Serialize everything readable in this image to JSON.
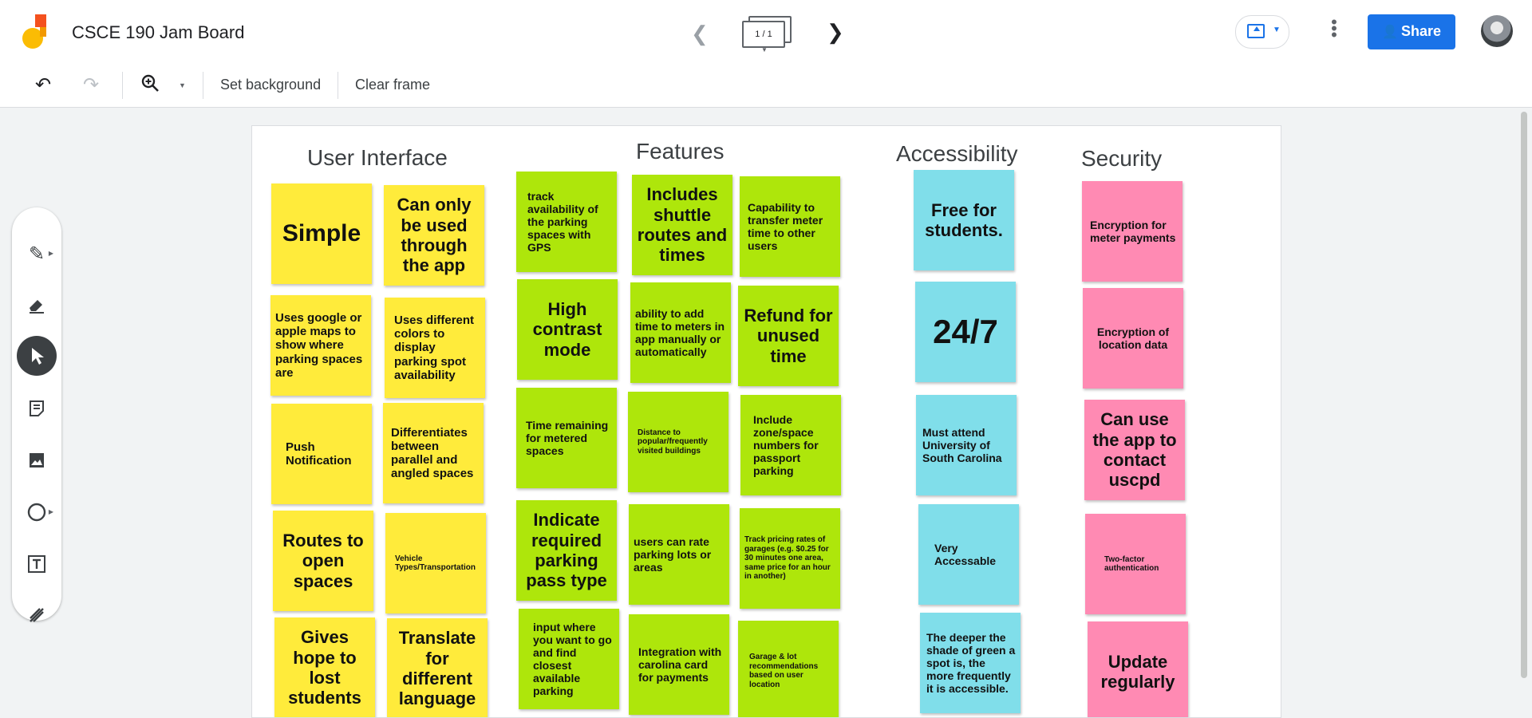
{
  "header": {
    "title": "CSCE 190 Jam Board",
    "frame_indicator": "1 / 1",
    "share_label": "Share"
  },
  "toolbar": {
    "set_background": "Set background",
    "clear_frame": "Clear frame"
  },
  "columns": {
    "ui": "User Interface",
    "features": "Features",
    "accessibility": "Accessibility",
    "security": "Security"
  },
  "notes": {
    "ui": [
      "Simple",
      "Can only be used through the app",
      "Uses google or apple maps to show where parking spaces are",
      "Uses different colors to display parking spot availability",
      "Push Notification",
      "Differentiates between parallel and angled spaces",
      "Routes to open spaces",
      "Vehicle Types/Transportation",
      "Gives hope to lost students",
      "Translate for different language"
    ],
    "features": [
      "track availability of the parking spaces with GPS",
      "Includes shuttle routes and times",
      "Capability to transfer meter time to other users",
      "High contrast mode",
      "ability to add time to meters in app manually or automatically",
      "Refund for unused time",
      "Time remaining for metered spaces",
      "Distance to popular/frequently visited buildings",
      "Include zone/space numbers for passport parking",
      "Indicate required parking pass type",
      "users can rate parking lots or areas",
      "Track pricing rates of garages (e.g. $0.25 for 30 minutes one area, same price for an hour in another)",
      "input where you want to go and find closest available parking",
      "Integration with carolina card for payments",
      "Garage & lot recommendations based on user location"
    ],
    "accessibility": [
      "Free for students.",
      "24/7",
      "Must attend University of South Carolina",
      "Very Accessable",
      "The deeper the shade of green a spot is, the more frequently it is accessible."
    ],
    "security": [
      "Encryption for meter payments",
      "Encryption of location data",
      "Can use the app to contact uscpd",
      "Two-factor authentication",
      "Update regularly"
    ]
  },
  "colors": {
    "yellow": "#ffeb3b",
    "green": "#aee60b",
    "cyan": "#80deea",
    "pink": "#ff8ab3",
    "share": "#1a73e8"
  },
  "icons": [
    "undo-icon",
    "redo-icon",
    "zoom-icon",
    "pen-icon",
    "eraser-icon",
    "select-icon",
    "sticky-note-icon",
    "image-icon",
    "circle-icon",
    "text-box-icon",
    "laser-icon"
  ]
}
